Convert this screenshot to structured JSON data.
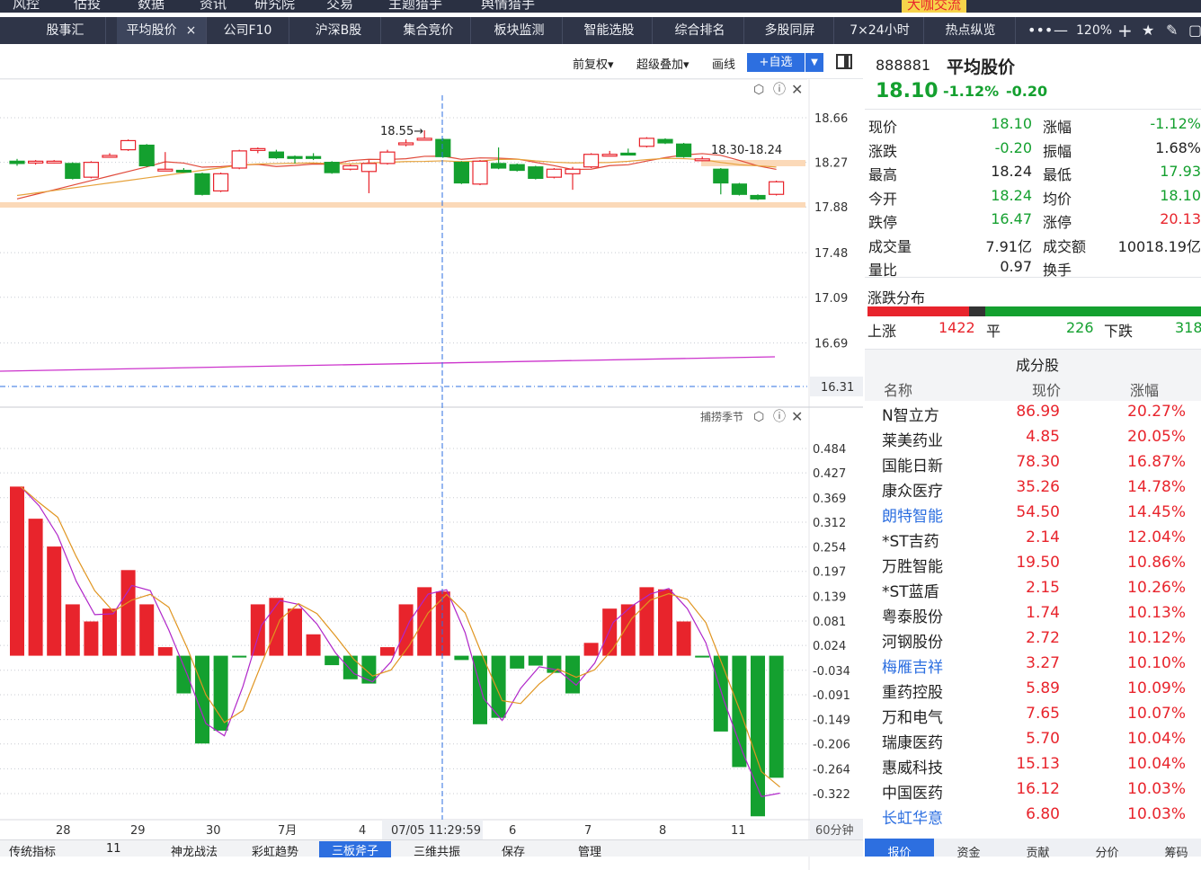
{
  "top_menu": [
    "风控",
    "估投",
    "数据",
    "资讯",
    "研究院",
    "交易",
    "主题猎手",
    "舆情猎手"
  ],
  "top_right": {
    "community": "大咖交流"
  },
  "tabs": [
    {
      "label": "股事汇"
    },
    {
      "label": "平均股价",
      "active": true,
      "close": "×"
    },
    {
      "label": "公司F10"
    },
    {
      "label": "沪深B股"
    },
    {
      "label": "集合竞价"
    },
    {
      "label": "板块监测"
    },
    {
      "label": "智能选股"
    },
    {
      "label": "综合排名"
    },
    {
      "label": "多股同屏"
    },
    {
      "label": "7×24小时"
    },
    {
      "label": "热点纵览"
    }
  ],
  "zoom": "120%",
  "toolbar": {
    "fuquan": "前复权",
    "overlay": "超级叠加",
    "draw": "画线",
    "add": "+自选"
  },
  "main_chart": {
    "price_axis": [
      "18.66",
      "18.27",
      "17.88",
      "17.48",
      "17.09",
      "16.69",
      "16.31"
    ],
    "current_price_label": "16.31",
    "high_label": "18.55",
    "range_label": "18.30-18.24",
    "candles": [
      {
        "o": 18.28,
        "c": 18.26,
        "h": 18.3,
        "l": 18.24
      },
      {
        "o": 18.27,
        "c": 18.28,
        "h": 18.29,
        "l": 18.25
      },
      {
        "o": 18.28,
        "c": 18.28,
        "h": 18.29,
        "l": 18.26
      },
      {
        "o": 18.26,
        "c": 18.13,
        "h": 18.27,
        "l": 18.12
      },
      {
        "o": 18.14,
        "c": 18.27,
        "h": 18.28,
        "l": 18.13
      },
      {
        "o": 18.33,
        "c": 18.33,
        "h": 18.35,
        "l": 18.31
      },
      {
        "o": 18.38,
        "c": 18.46,
        "h": 18.47,
        "l": 18.37
      },
      {
        "o": 18.42,
        "c": 18.24,
        "h": 18.43,
        "l": 18.23
      },
      {
        "o": 18.2,
        "c": 18.21,
        "h": 18.36,
        "l": 18.2
      },
      {
        "o": 18.2,
        "c": 18.19,
        "h": 18.22,
        "l": 18.18
      },
      {
        "o": 18.17,
        "c": 17.99,
        "h": 18.18,
        "l": 17.98
      },
      {
        "o": 18.02,
        "c": 18.17,
        "h": 18.18,
        "l": 18.01
      },
      {
        "o": 18.22,
        "c": 18.37,
        "h": 18.38,
        "l": 18.21
      },
      {
        "o": 18.38,
        "c": 18.39,
        "h": 18.4,
        "l": 18.35
      },
      {
        "o": 18.36,
        "c": 18.31,
        "h": 18.38,
        "l": 18.3
      },
      {
        "o": 18.32,
        "c": 18.31,
        "h": 18.33,
        "l": 18.26
      },
      {
        "o": 18.32,
        "c": 18.31,
        "h": 18.35,
        "l": 18.29
      },
      {
        "o": 18.27,
        "c": 18.18,
        "h": 18.28,
        "l": 18.17
      },
      {
        "o": 18.21,
        "c": 18.24,
        "h": 18.25,
        "l": 18.2
      },
      {
        "o": 18.19,
        "c": 18.26,
        "h": 18.29,
        "l": 18.0
      },
      {
        "o": 18.26,
        "c": 18.36,
        "h": 18.38,
        "l": 18.25
      },
      {
        "o": 18.43,
        "c": 18.44,
        "h": 18.47,
        "l": 18.41
      },
      {
        "o": 18.47,
        "c": 18.48,
        "h": 18.55,
        "l": 18.46
      },
      {
        "o": 18.47,
        "c": 18.32,
        "h": 18.48,
        "l": 18.31
      },
      {
        "o": 18.27,
        "c": 18.09,
        "h": 18.28,
        "l": 18.08
      },
      {
        "o": 18.08,
        "c": 18.28,
        "h": 18.29,
        "l": 18.07
      },
      {
        "o": 18.26,
        "c": 18.22,
        "h": 18.4,
        "l": 18.21
      },
      {
        "o": 18.25,
        "c": 18.2,
        "h": 18.26,
        "l": 18.19
      },
      {
        "o": 18.23,
        "c": 18.13,
        "h": 18.24,
        "l": 18.12
      },
      {
        "o": 18.14,
        "c": 18.21,
        "h": 18.22,
        "l": 18.13
      },
      {
        "o": 18.17,
        "c": 18.21,
        "h": 18.23,
        "l": 18.03
      },
      {
        "o": 18.23,
        "c": 18.34,
        "h": 18.35,
        "l": 18.22
      },
      {
        "o": 18.34,
        "c": 18.34,
        "h": 18.37,
        "l": 18.33
      },
      {
        "o": 18.35,
        "c": 18.34,
        "h": 18.39,
        "l": 18.33
      },
      {
        "o": 18.41,
        "c": 18.48,
        "h": 18.49,
        "l": 18.4
      },
      {
        "o": 18.47,
        "c": 18.44,
        "h": 18.48,
        "l": 18.43
      },
      {
        "o": 18.43,
        "c": 18.32,
        "h": 18.44,
        "l": 18.31
      },
      {
        "o": 18.3,
        "c": 18.3,
        "h": 18.32,
        "l": 18.28
      },
      {
        "o": 18.21,
        "c": 18.09,
        "h": 18.22,
        "l": 17.99
      },
      {
        "o": 18.08,
        "c": 17.99,
        "h": 18.09,
        "l": 17.98
      },
      {
        "o": 17.98,
        "c": 17.95,
        "h": 17.99,
        "l": 17.94
      },
      {
        "o": 17.99,
        "c": 18.1,
        "h": 18.11,
        "l": 17.98
      }
    ]
  },
  "sub_chart": {
    "label": "捕捞季节",
    "axis": [
      "0.484",
      "0.427",
      "0.369",
      "0.312",
      "0.254",
      "0.197",
      "0.139",
      "0.081",
      "0.024",
      "-0.034",
      "-0.091",
      "-0.149",
      "-0.206",
      "-0.264",
      "-0.322"
    ],
    "bars": [
      0.395,
      0.32,
      0.255,
      0.12,
      0.08,
      0.11,
      0.2,
      0.12,
      0.02,
      -0.088,
      -0.205,
      -0.175,
      -0.003,
      0.12,
      0.135,
      0.11,
      0.05,
      -0.022,
      -0.055,
      -0.065,
      0.02,
      0.12,
      0.16,
      0.15,
      -0.01,
      -0.16,
      -0.145,
      -0.03,
      -0.023,
      -0.04,
      -0.088,
      0.03,
      0.11,
      0.12,
      0.16,
      0.155,
      0.08,
      -0.003,
      -0.177,
      -0.26,
      -0.375,
      -0.285
    ]
  },
  "time_axis": [
    "28",
    "29",
    "30",
    "7月",
    "4",
    "6",
    "7",
    "8",
    "11"
  ],
  "crosshair_time": "07/05 11:29:59",
  "period": "60分钟",
  "bottom_tabs": [
    "传统指标",
    "11",
    "神龙战法",
    "彩虹趋势",
    "三板斧子",
    "三维共振",
    "保存",
    "管理"
  ],
  "quote": {
    "code": "888881",
    "name": "平均股价",
    "price": "18.10",
    "change_pct": "-1.12%",
    "change": "-0.20",
    "rows": [
      {
        "l1": "现价",
        "v1": "18.10",
        "l2": "涨幅",
        "v2": "-1.12%"
      },
      {
        "l1": "涨跌",
        "v1": "-0.20",
        "l2": "振幅",
        "v2": "1.68%"
      },
      {
        "l1": "最高",
        "v1": "18.24",
        "l2": "最低",
        "v2": "17.93"
      },
      {
        "l1": "今开",
        "v1": "18.24",
        "l2": "均价",
        "v2": "18.10"
      },
      {
        "l1": "跌停",
        "v1": "16.47",
        "l2": "涨停",
        "v2": "20.13"
      },
      {
        "l1": "成交量",
        "v1": "7.91亿",
        "l2": "成交额",
        "v2": "10018.19亿"
      },
      {
        "l1": "量比",
        "v1": "0.97",
        "l2": "换手",
        "v2": ""
      }
    ]
  },
  "distribution": {
    "title": "涨跌分布",
    "up_label": "上涨",
    "up": "1422",
    "flat_label": "平",
    "flat": "226",
    "down_label": "下跌",
    "down": "318"
  },
  "constituents": {
    "title": "成分股",
    "headers": [
      "名称",
      "现价",
      "涨幅"
    ],
    "rows": [
      {
        "name": "N智立方",
        "price": "86.99",
        "pct": "20.27%"
      },
      {
        "name": "莱美药业",
        "price": "4.85",
        "pct": "20.05%"
      },
      {
        "name": "国能日新",
        "price": "78.30",
        "pct": "16.87%"
      },
      {
        "name": "康众医疗",
        "price": "35.26",
        "pct": "14.78%"
      },
      {
        "name": "朗特智能",
        "price": "54.50",
        "pct": "14.45%",
        "link": true
      },
      {
        "name": "*ST吉药",
        "price": "2.14",
        "pct": "12.04%"
      },
      {
        "name": "万胜智能",
        "price": "19.50",
        "pct": "10.86%"
      },
      {
        "name": "*ST蓝盾",
        "price": "2.15",
        "pct": "10.26%"
      },
      {
        "name": "粤泰股份",
        "price": "1.74",
        "pct": "10.13%"
      },
      {
        "name": "河钢股份",
        "price": "2.72",
        "pct": "10.12%"
      },
      {
        "name": "梅雁吉祥",
        "price": "3.27",
        "pct": "10.10%",
        "link": true
      },
      {
        "name": "重药控股",
        "price": "5.89",
        "pct": "10.09%"
      },
      {
        "name": "万和电气",
        "price": "7.65",
        "pct": "10.07%"
      },
      {
        "name": "瑞康医药",
        "price": "5.70",
        "pct": "10.04%"
      },
      {
        "name": "惠威科技",
        "price": "15.13",
        "pct": "10.04%"
      },
      {
        "name": "中国医药",
        "price": "16.12",
        "pct": "10.03%"
      },
      {
        "name": "长虹华意",
        "price": "6.80",
        "pct": "10.03%",
        "link": true
      }
    ]
  },
  "right_bottom_tabs": [
    "报价",
    "资金",
    "贡献",
    "分价",
    "筹码"
  ],
  "colors": {
    "up": "#e8242c",
    "down": "#14a02f",
    "accent": "#2d6fe0",
    "header": "#2f3548",
    "band": "#fbd9b8",
    "ma_fast": "#e0493a",
    "ma_slow": "#e6a23c",
    "ma_long": "#cc33cc"
  }
}
